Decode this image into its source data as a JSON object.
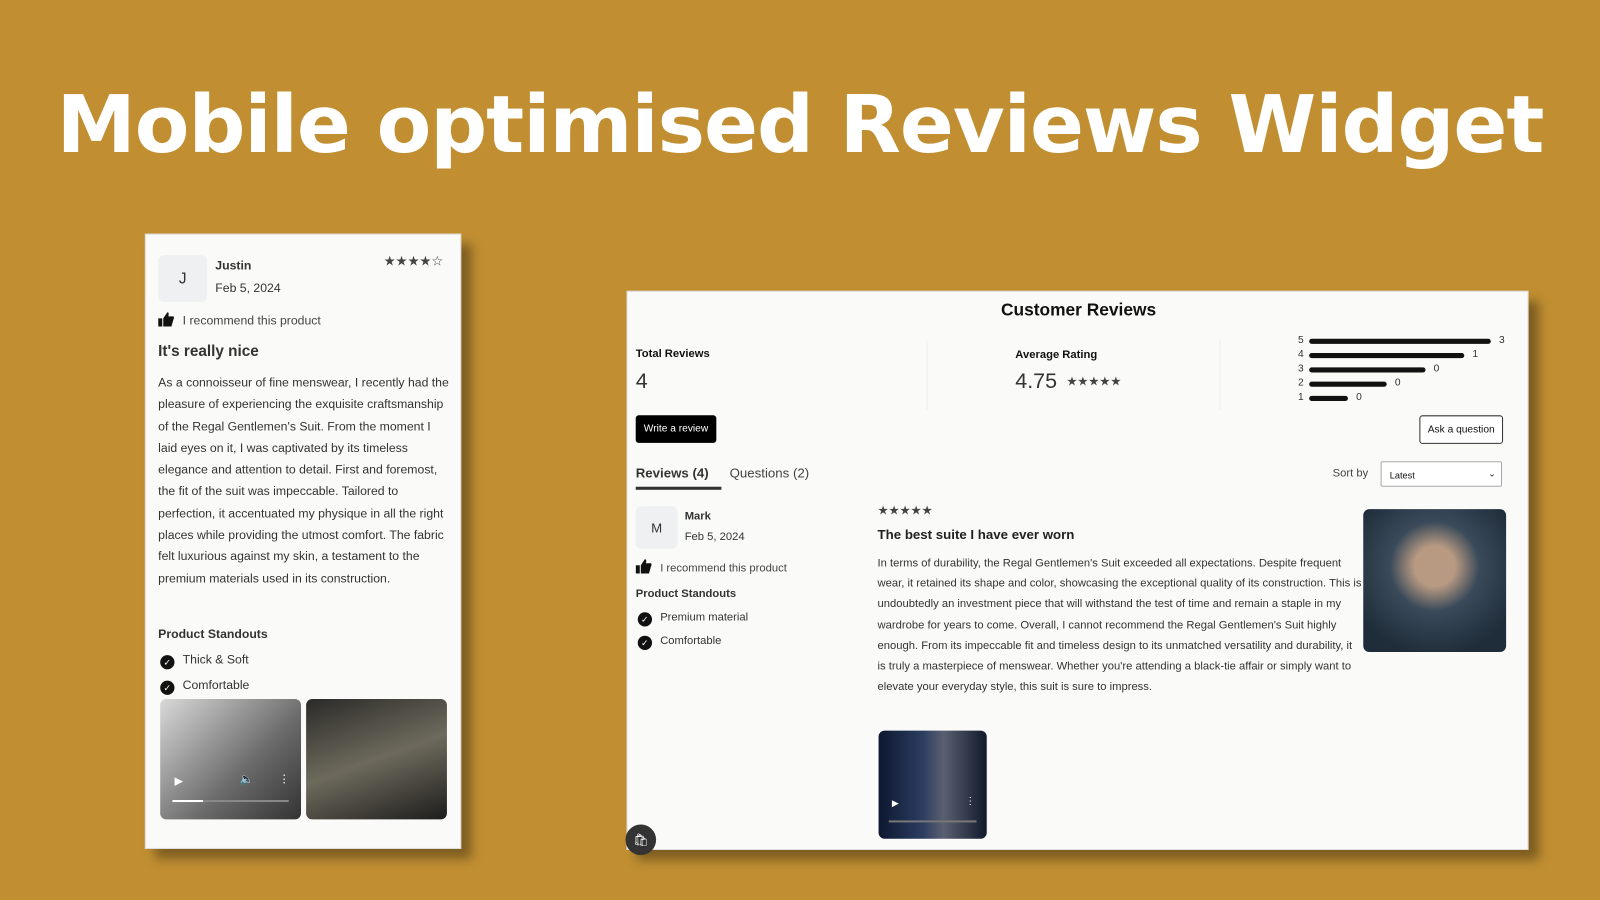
{
  "headline": "Mobile optimised Reviews Widget",
  "mobile": {
    "avatar_letter": "J",
    "name": "Justin",
    "date": "Feb 5, 2024",
    "rating": 4,
    "recommend": "I recommend this product",
    "title": "It's really nice",
    "body": "As a connoisseur of fine menswear, I recently had the pleasure of experiencing the exquisite craftsmanship of the Regal Gentlemen's Suit. From the moment I laid eyes on it, I was captivated by its timeless elegance and attention to detail. First and foremost, the fit of the suit was impeccable. Tailored to perfection, it accentuated my physique in all the right places while providing the utmost comfort. The fabric felt luxurious against my skin, a testament to the premium materials used in its construction.",
    "standouts_title": "Product Standouts",
    "standouts": [
      "Thick & Soft",
      "Comfortable"
    ]
  },
  "desktop": {
    "title": "Customer Reviews",
    "total_label": "Total Reviews",
    "total": "4",
    "avg_label": "Average Rating",
    "avg": "4.75",
    "avg_stars": 5,
    "distribution": [
      {
        "star": "5",
        "count": "3"
      },
      {
        "star": "4",
        "count": "1"
      },
      {
        "star": "3",
        "count": "0"
      },
      {
        "star": "2",
        "count": "0"
      },
      {
        "star": "1",
        "count": "0"
      }
    ],
    "write_review": "Write a review",
    "ask_question": "Ask a question",
    "tabs": [
      "Reviews (4)",
      "Questions (2)"
    ],
    "sort_label": "Sort by",
    "sort_value": "Latest",
    "review": {
      "avatar_letter": "M",
      "name": "Mark",
      "date": "Feb 5, 2024",
      "rating": 5,
      "recommend": "I recommend this product",
      "standouts_title": "Product Standouts",
      "standouts": [
        "Premium material",
        "Comfortable"
      ],
      "title": "The best suite I have ever worn",
      "body": "In terms of durability, the Regal Gentlemen's Suit exceeded all expectations. Despite frequent wear, it retained its shape and color, showcasing the exceptional quality of its construction. This is undoubtedly an investment piece that will withstand the test of time and remain a staple in my wardrobe for years to come. Overall, I cannot recommend the Regal Gentlemen's Suit highly enough. From its impeccable fit and timeless design to its unmatched versatility and durability, it is truly a masterpiece of menswear. Whether you're attending a black-tie affair or simply want to elevate your everyday style, this suit is sure to impress."
    }
  },
  "colors": {
    "background": "#c18f32",
    "card": "#fafaf8",
    "button": "#000000"
  }
}
